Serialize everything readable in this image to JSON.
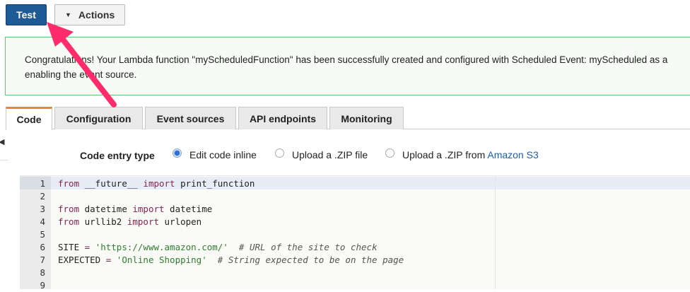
{
  "toolbar": {
    "test_label": "Test",
    "actions_label": "Actions"
  },
  "banner": {
    "text": "Congratulations! Your Lambda function \"myScheduledFunction\" has been successfully created and configured with Scheduled Event: myScheduled as a enabling the event source."
  },
  "tabs": [
    {
      "label": "Code",
      "active": true
    },
    {
      "label": "Configuration",
      "active": false
    },
    {
      "label": "Event sources",
      "active": false
    },
    {
      "label": "API endpoints",
      "active": false
    },
    {
      "label": "Monitoring",
      "active": false
    }
  ],
  "code_entry": {
    "label": "Code entry type",
    "options": [
      {
        "label": "Edit code inline",
        "selected": true
      },
      {
        "label": "Upload a .ZIP file",
        "selected": false
      },
      {
        "label": "Upload a .ZIP from ",
        "link": "Amazon S3",
        "selected": false
      }
    ]
  },
  "editor": {
    "line_numbers": [
      "1",
      "2",
      "3",
      "4",
      "5",
      "6",
      "7",
      "8",
      "9"
    ],
    "lines": [
      [
        {
          "t": "kw",
          "v": "from"
        },
        {
          "t": "",
          "v": " __future__ "
        },
        {
          "t": "kw",
          "v": "import"
        },
        {
          "t": "",
          "v": " print_function"
        }
      ],
      [],
      [
        {
          "t": "kw",
          "v": "from"
        },
        {
          "t": "",
          "v": " datetime "
        },
        {
          "t": "kw",
          "v": "import"
        },
        {
          "t": "",
          "v": " datetime"
        }
      ],
      [
        {
          "t": "kw",
          "v": "from"
        },
        {
          "t": "",
          "v": " urllib2 "
        },
        {
          "t": "kw",
          "v": "import"
        },
        {
          "t": "",
          "v": " urlopen"
        }
      ],
      [],
      [
        {
          "t": "",
          "v": "SITE "
        },
        {
          "t": "op",
          "v": "="
        },
        {
          "t": "",
          "v": " "
        },
        {
          "t": "str",
          "v": "'https://www.amazon.com/'"
        },
        {
          "t": "",
          "v": "  "
        },
        {
          "t": "cmt",
          "v": "# URL of the site to check"
        }
      ],
      [
        {
          "t": "",
          "v": "EXPECTED "
        },
        {
          "t": "op",
          "v": "="
        },
        {
          "t": "",
          "v": " "
        },
        {
          "t": "str",
          "v": "'Online Shopping'"
        },
        {
          "t": "",
          "v": "  "
        },
        {
          "t": "cmt",
          "v": "# String expected to be on the page"
        }
      ],
      [],
      []
    ]
  },
  "colors": {
    "test_button": "#1e5a96",
    "active_tab_accent": "#e08a2b",
    "banner_border": "#6bc36b",
    "annotation_arrow": "#ff2b6a"
  }
}
